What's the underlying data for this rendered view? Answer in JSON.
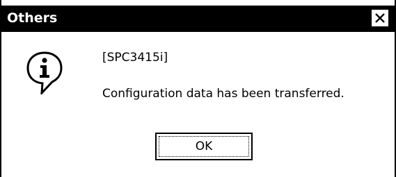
{
  "dialog": {
    "title": "Others",
    "close_glyph": "✕",
    "icon": "information-icon",
    "message_lines": [
      "[SPC3415i]",
      "Configuration data has been transferred."
    ],
    "ok_label": "OK"
  },
  "colors": {
    "title_bar_bg": "#000000",
    "title_text": "#ffffff",
    "dialog_bg": "#ffffff",
    "text": "#000000"
  }
}
